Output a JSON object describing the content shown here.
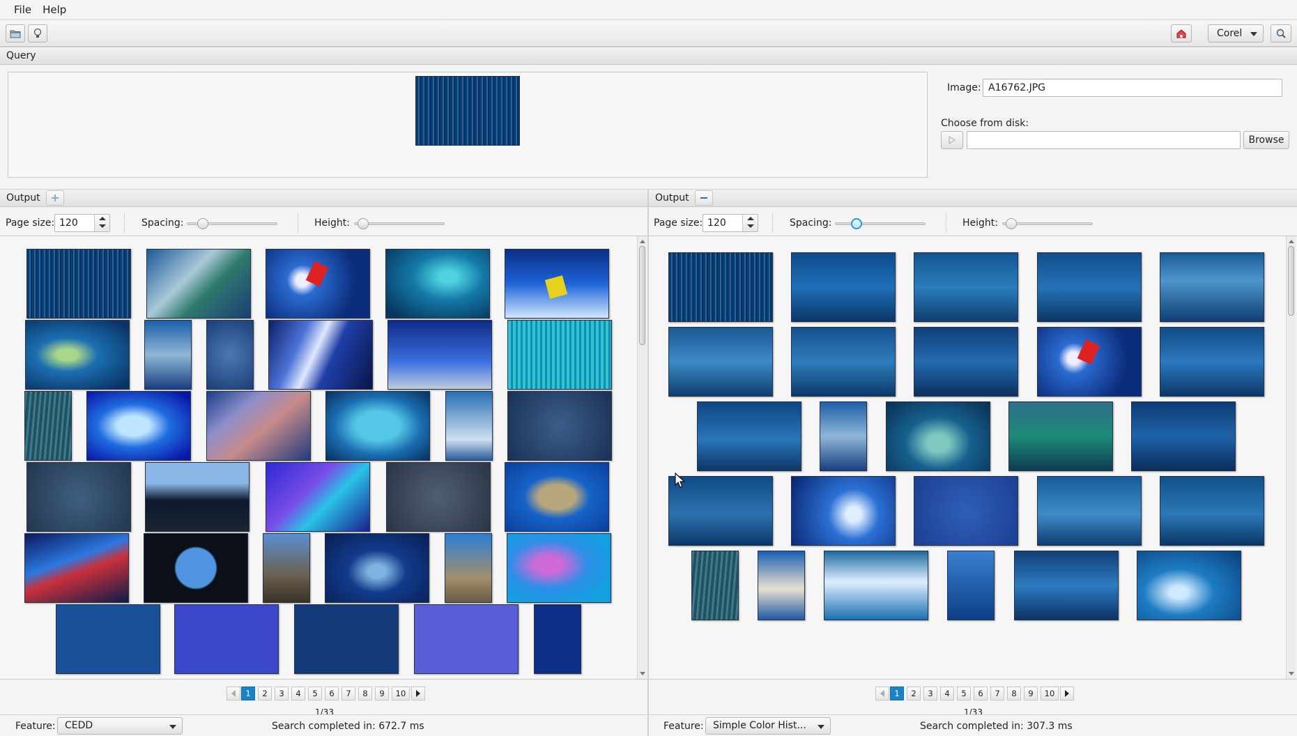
{
  "menu": {
    "items": [
      "File",
      "Help"
    ]
  },
  "toolbar": {
    "open_icon": "folder-open-icon",
    "tip_icon": "lightbulb-icon",
    "home_icon": "home-icon",
    "dataset": "Corel",
    "search_icon": "search-icon"
  },
  "query": {
    "header": "Query",
    "image_label": "Image:",
    "image_value": "A16762.JPG",
    "disk_label": "Choose from disk:",
    "disk_value": "",
    "browse_label": "Browse"
  },
  "left_pane": {
    "header": "Output",
    "page_size_label": "Page size:",
    "page_size": "120",
    "spacing_label": "Spacing:",
    "spacing_value": 0.15,
    "height_label": "Height:",
    "height_value": 0.1,
    "pages": [
      "1",
      "2",
      "3",
      "4",
      "5",
      "6",
      "7",
      "8",
      "9",
      "10"
    ],
    "current_page": "1",
    "page_count": "1/33",
    "feature_label": "Feature:",
    "feature": "CEDD",
    "status": "Search completed in: 672.7 ms"
  },
  "right_pane": {
    "header": "Output",
    "page_size_label": "Page size:",
    "page_size": "120",
    "spacing_label": "Spacing:",
    "spacing_value": 0.25,
    "height_label": "Height:",
    "height_value": 0.1,
    "pages": [
      "1",
      "2",
      "3",
      "4",
      "5",
      "6",
      "7",
      "8",
      "9",
      "10"
    ],
    "current_page": "1",
    "page_count": "1/33",
    "feature_label": "Feature:",
    "feature": "Simple Color Hist...",
    "status": "Search completed in: 307.3 ms"
  }
}
